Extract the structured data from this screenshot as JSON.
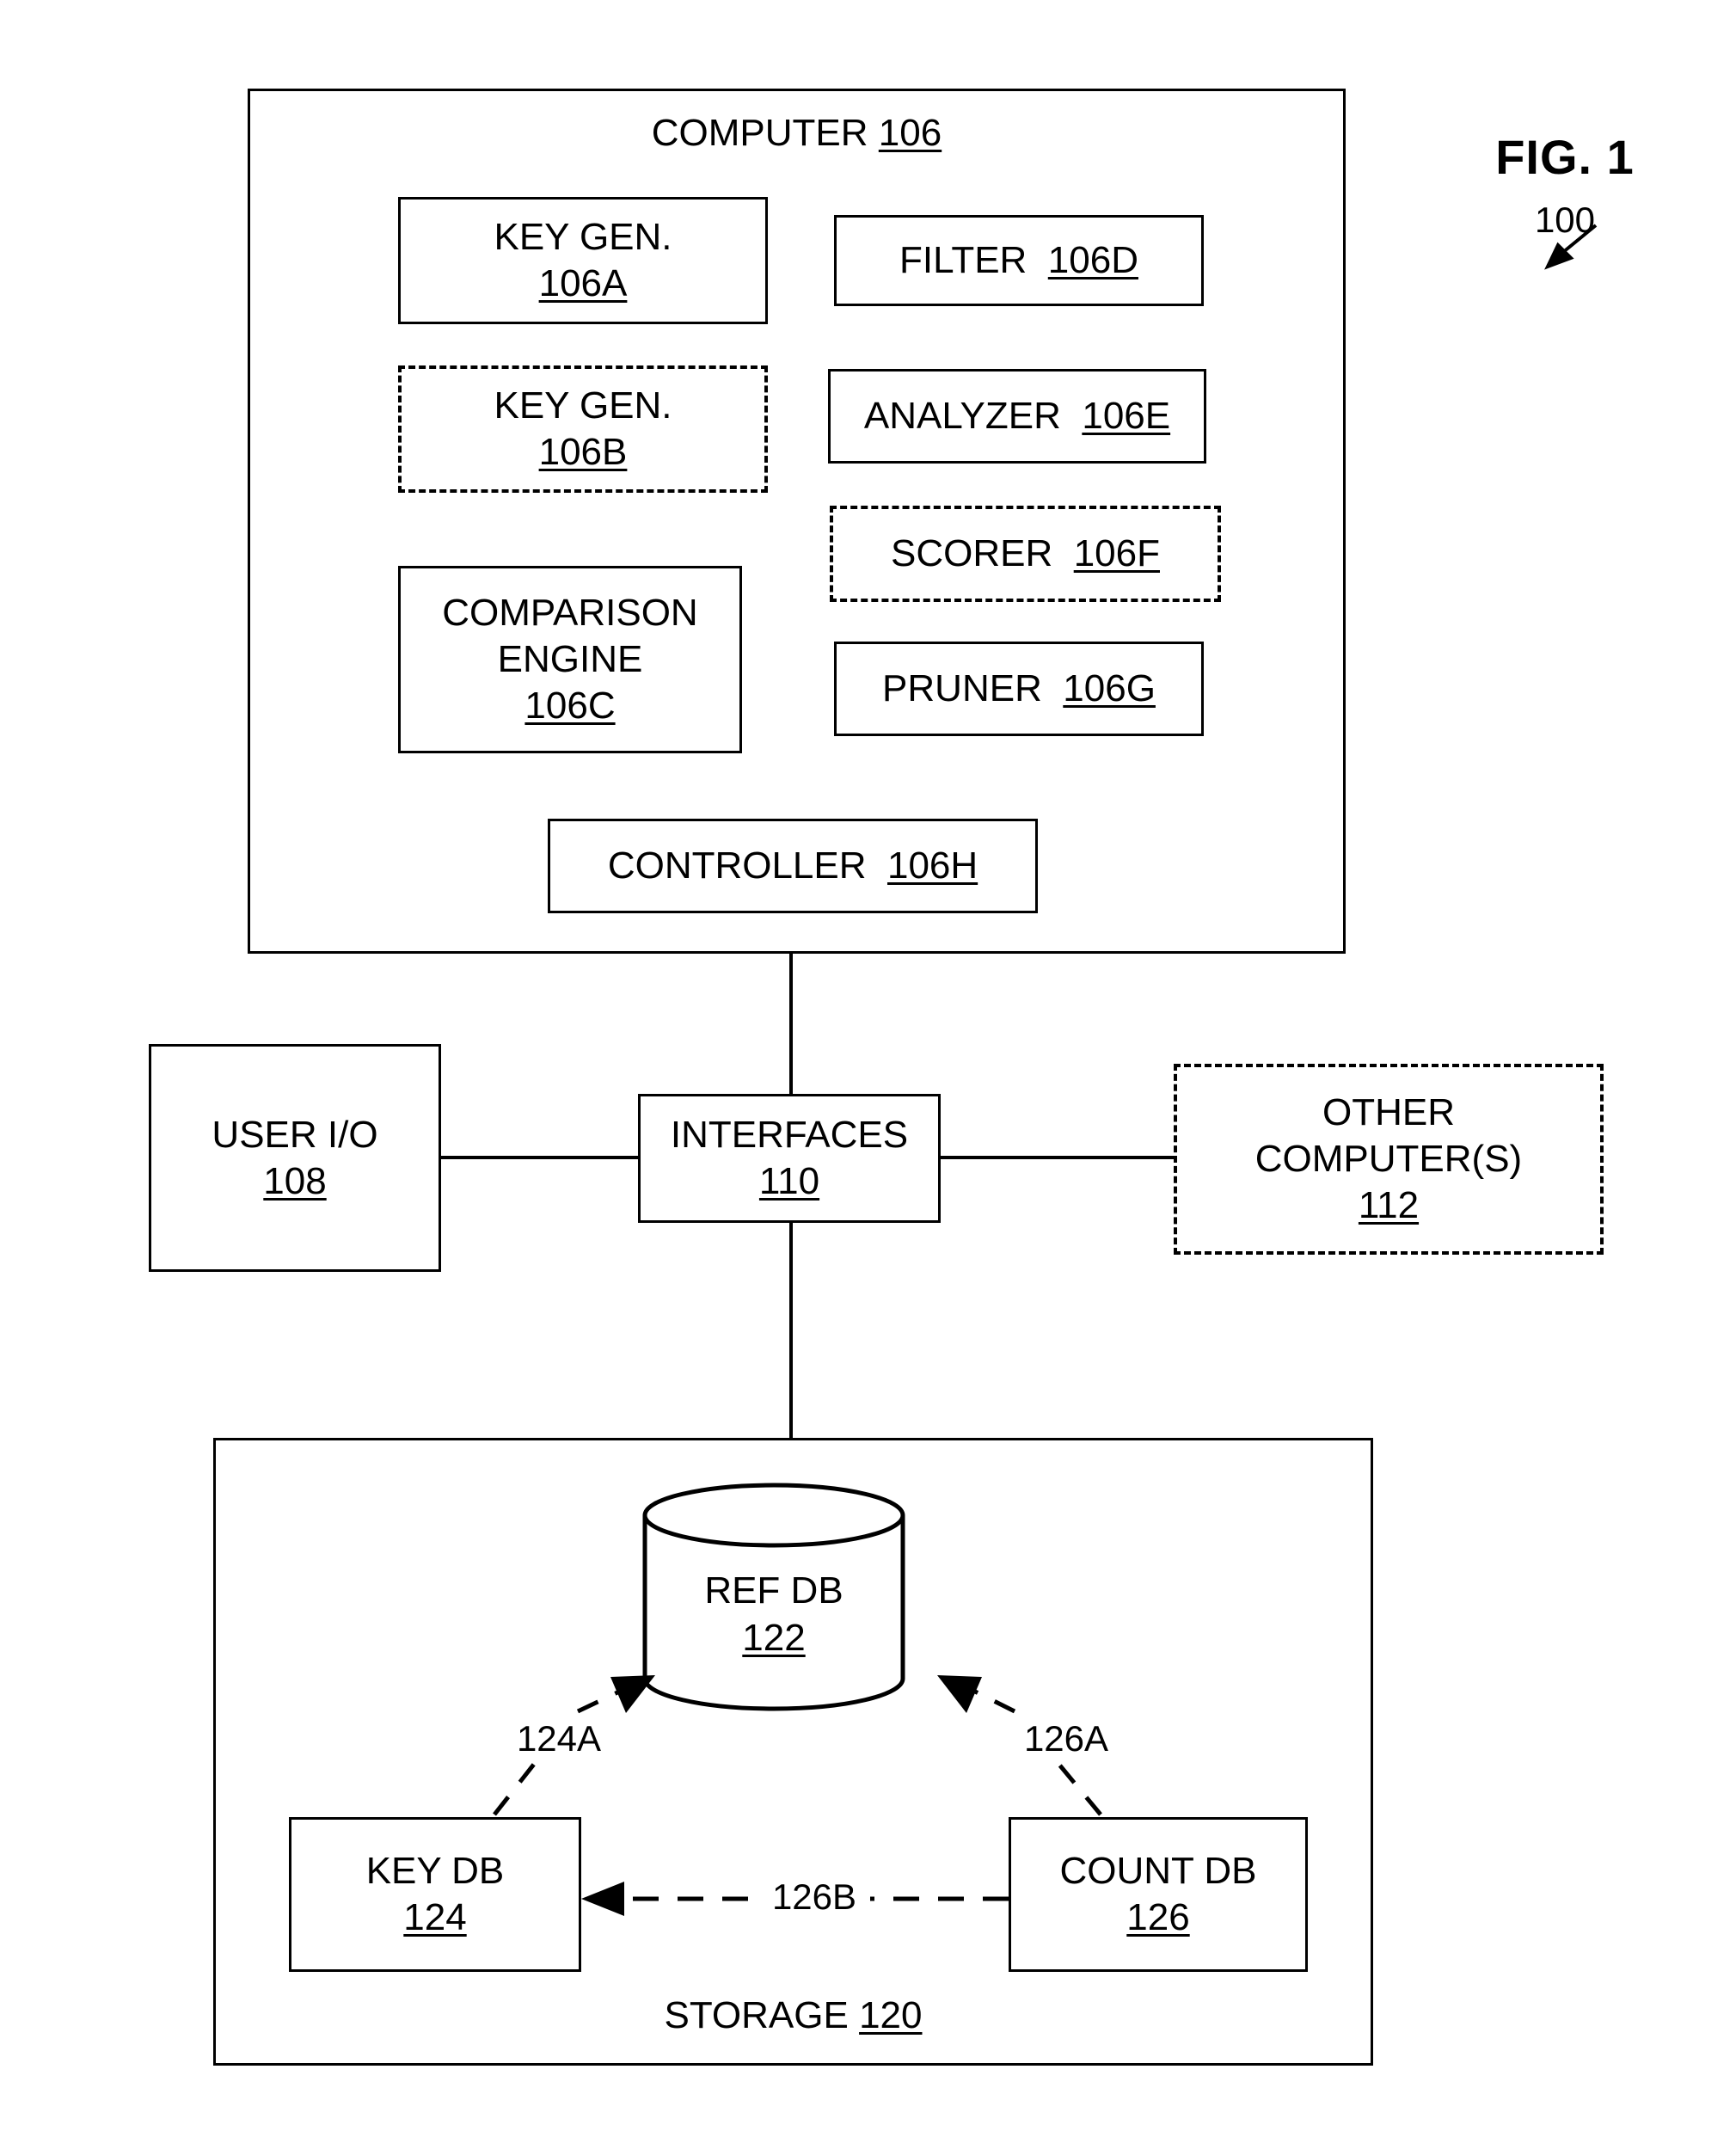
{
  "figure": {
    "label": "FIG. 1",
    "reference_numeral": "100"
  },
  "computer": {
    "title_text": "COMPUTER",
    "title_ref": "106",
    "modules": [
      {
        "name": "key-gen-a",
        "label": "KEY GEN.",
        "ref": "106A",
        "style": "solid",
        "layout": "stacked"
      },
      {
        "name": "key-gen-b",
        "label": "KEY GEN.",
        "ref": "106B",
        "style": "dashed",
        "layout": "stacked"
      },
      {
        "name": "comparison-engine",
        "label": "COMPARISON ENGINE",
        "ref": "106C",
        "style": "solid",
        "layout": "stacked"
      },
      {
        "name": "filter",
        "label": "FILTER",
        "ref": "106D",
        "style": "solid",
        "layout": "inline"
      },
      {
        "name": "analyzer",
        "label": "ANALYZER",
        "ref": "106E",
        "style": "solid",
        "layout": "inline"
      },
      {
        "name": "scorer",
        "label": "SCORER",
        "ref": "106F",
        "style": "dashed",
        "layout": "inline"
      },
      {
        "name": "pruner",
        "label": "PRUNER",
        "ref": "106G",
        "style": "solid",
        "layout": "inline"
      },
      {
        "name": "controller",
        "label": "CONTROLLER",
        "ref": "106H",
        "style": "solid",
        "layout": "inline"
      }
    ]
  },
  "middle": {
    "user_io": {
      "label": "USER I/O",
      "ref": "108",
      "style": "solid"
    },
    "interfaces": {
      "label": "INTERFACES",
      "ref": "110",
      "style": "solid"
    },
    "other_computers": {
      "label_line1": "OTHER",
      "label_line2": "COMPUTER(S)",
      "ref": "112",
      "style": "dashed"
    }
  },
  "storage": {
    "title_text": "STORAGE",
    "title_ref": "120",
    "ref_db": {
      "label": "REF DB",
      "ref": "122",
      "shape": "cylinder"
    },
    "key_db": {
      "label": "KEY DB",
      "ref": "124",
      "style": "solid"
    },
    "count_db": {
      "label": "COUNT DB",
      "ref": "126",
      "style": "solid"
    },
    "connectors": [
      {
        "name": "key-db-to-ref-db",
        "label": "124A",
        "style": "dashed-arrow"
      },
      {
        "name": "count-db-to-ref-db",
        "label": "126A",
        "style": "dashed-arrow"
      },
      {
        "name": "count-db-to-key-db",
        "label": "126B",
        "style": "dashed-arrow"
      }
    ]
  },
  "colors": {
    "ink": "#000000",
    "paper": "#ffffff"
  }
}
